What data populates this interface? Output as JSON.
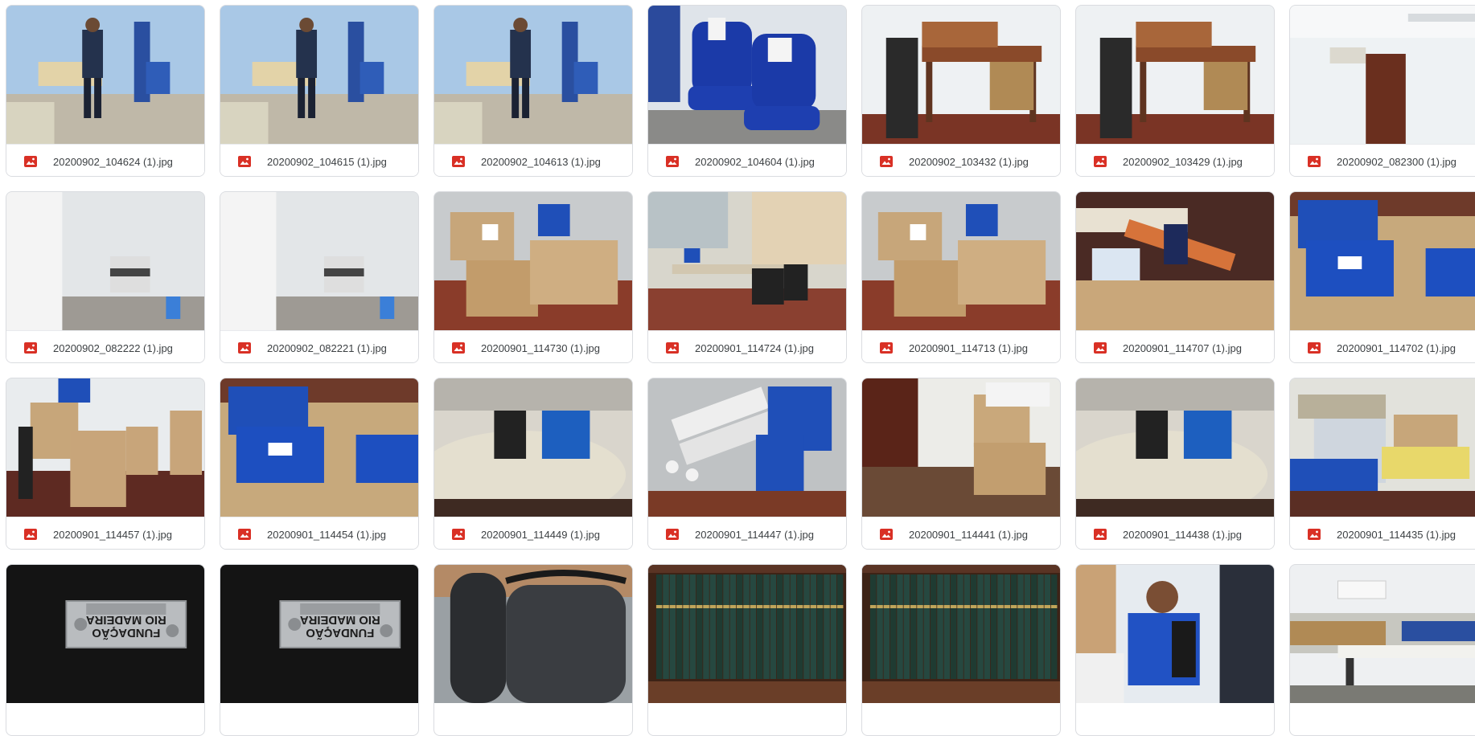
{
  "files": [
    {
      "name": "20200902_104624 (1).jpg",
      "scene": "room-person"
    },
    {
      "name": "20200902_104615 (1).jpg",
      "scene": "room-person"
    },
    {
      "name": "20200902_104613 (1).jpg",
      "scene": "room-person"
    },
    {
      "name": "20200902_104604 (1).jpg",
      "scene": "chairs"
    },
    {
      "name": "20200902_103432 (1).jpg",
      "scene": "desk-wood"
    },
    {
      "name": "20200902_103429 (1).jpg",
      "scene": "desk-wood"
    },
    {
      "name": "20200902_082300 (1).jpg",
      "scene": "white-room"
    },
    {
      "name": "20200902_082222 (1).jpg",
      "scene": "printer"
    },
    {
      "name": "20200902_082221 (1).jpg",
      "scene": "printer"
    },
    {
      "name": "20200901_114730 (1).jpg",
      "scene": "boxes"
    },
    {
      "name": "20200901_114724 (1).jpg",
      "scene": "office"
    },
    {
      "name": "20200901_114713 (1).jpg",
      "scene": "boxes"
    },
    {
      "name": "20200901_114707 (1).jpg",
      "scene": "boxes-tube"
    },
    {
      "name": "20200901_114702 (1).jpg",
      "scene": "blue-boxes"
    },
    {
      "name": "20200901_114457 (1).jpg",
      "scene": "boxes-chairs"
    },
    {
      "name": "20200901_114454 (1).jpg",
      "scene": "blue-boxes"
    },
    {
      "name": "20200901_114449 (1).jpg",
      "scene": "table"
    },
    {
      "name": "20200901_114447 (1).jpg",
      "scene": "rolls"
    },
    {
      "name": "20200901_114441 (1).jpg",
      "scene": "boxes-floor"
    },
    {
      "name": "20200901_114438 (1).jpg",
      "scene": "table"
    },
    {
      "name": "20200901_114435 (1).jpg",
      "scene": "papers"
    },
    {
      "name": "",
      "scene": "plate",
      "plate_lines": [
        "FUNDAÇÃO",
        "RIO MADEIRA"
      ]
    },
    {
      "name": "",
      "scene": "plate",
      "plate_lines": [
        "FUNDAÇÃO",
        "RIO MADEIRA"
      ]
    },
    {
      "name": "",
      "scene": "chair-close"
    },
    {
      "name": "",
      "scene": "books"
    },
    {
      "name": "",
      "scene": "books"
    },
    {
      "name": "",
      "scene": "man"
    },
    {
      "name": "",
      "scene": "room-desk"
    }
  ],
  "icon": {
    "name": "image-file-icon",
    "color": "#d93025"
  },
  "colors": {
    "border": "#dadce0",
    "text": "#3c4043",
    "wall": "#e8ecef",
    "floor": "#7a3f2d",
    "box": "#c7a67a",
    "blue": "#1f4fb8"
  }
}
